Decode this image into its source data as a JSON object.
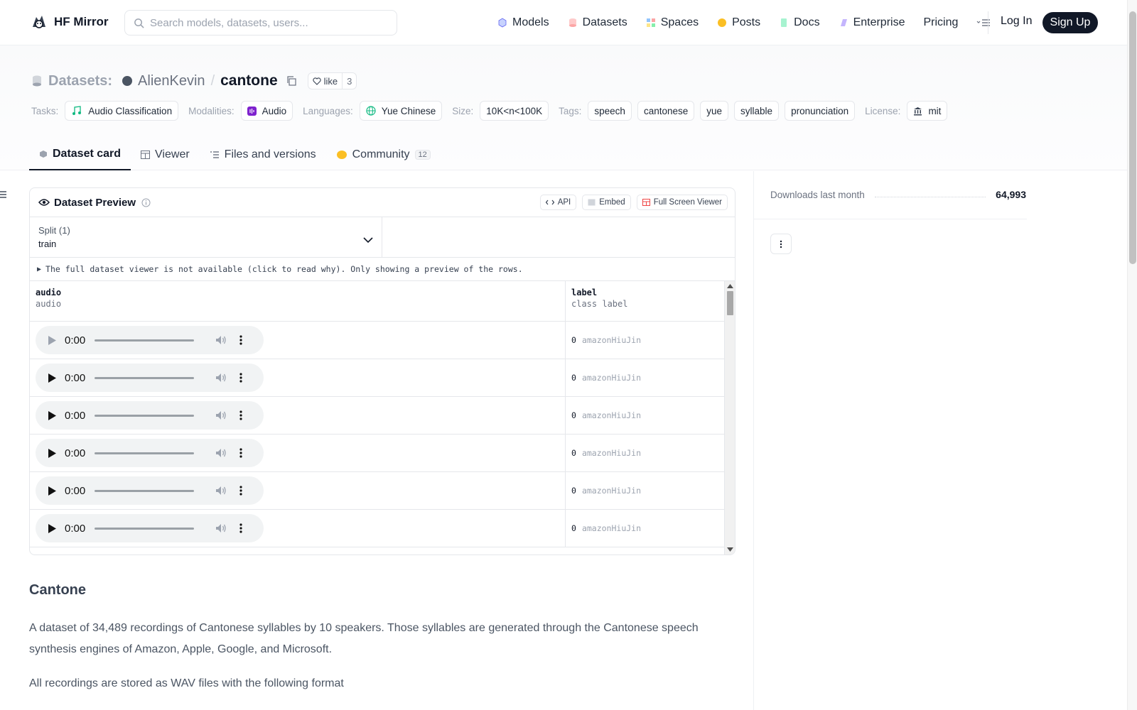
{
  "nav": {
    "brand": "HF Mirror",
    "search_placeholder": "Search models, datasets, users...",
    "links": [
      {
        "label": "Models",
        "icon": "models-icon",
        "color": "#6366f1"
      },
      {
        "label": "Datasets",
        "icon": "datasets-icon",
        "color": "#ef4444"
      },
      {
        "label": "Spaces",
        "icon": "spaces-icon",
        "color": "#3b82f6"
      },
      {
        "label": "Posts",
        "icon": "posts-icon",
        "color": "#f59e0b"
      },
      {
        "label": "Docs",
        "icon": "docs-icon",
        "color": "#10b981"
      },
      {
        "label": "Enterprise",
        "icon": "enterprise-icon",
        "color": "#8b5cf6"
      },
      {
        "label": "Pricing",
        "icon": "",
        "color": ""
      }
    ],
    "login": "Log In",
    "signup": "Sign Up"
  },
  "header": {
    "section_label": "Datasets:",
    "owner": "AlienKevin",
    "separator": "/",
    "repo": "cantone",
    "like_label": "like",
    "like_count": "3",
    "tags": {
      "tasks_label": "Tasks:",
      "task": "Audio Classification",
      "modalities_label": "Modalities:",
      "modality": "Audio",
      "languages_label": "Languages:",
      "language": "Yue Chinese",
      "size_label": "Size:",
      "size": "10K<n<100K",
      "tags_label": "Tags:",
      "tag_list": [
        "speech",
        "cantonese",
        "yue",
        "syllable",
        "pronunciation"
      ],
      "license_label": "License:",
      "license": "mit"
    },
    "tabs": [
      {
        "label": "Dataset card",
        "active": true
      },
      {
        "label": "Viewer",
        "active": false
      },
      {
        "label": "Files and versions",
        "active": false
      },
      {
        "label": "Community",
        "active": false,
        "count": "12"
      }
    ]
  },
  "preview": {
    "title": "Dataset Preview",
    "buttons": {
      "api": "API",
      "embed": "Embed",
      "fullscreen": "Full Screen Viewer"
    },
    "split_label": "Split (1)",
    "split_value": "train",
    "notice": "The full dataset viewer is not available (click to read why). Only showing a preview of the rows.",
    "columns": [
      {
        "name": "audio",
        "type": "audio"
      },
      {
        "name": "label",
        "type": "class label"
      }
    ],
    "rows": [
      {
        "time": "0:00",
        "label_idx": "0",
        "label_name": "amazonHiuJin"
      },
      {
        "time": "0:00",
        "label_idx": "0",
        "label_name": "amazonHiuJin"
      },
      {
        "time": "0:00",
        "label_idx": "0",
        "label_name": "amazonHiuJin"
      },
      {
        "time": "0:00",
        "label_idx": "0",
        "label_name": "amazonHiuJin"
      },
      {
        "time": "0:00",
        "label_idx": "0",
        "label_name": "amazonHiuJin"
      },
      {
        "time": "0:00",
        "label_idx": "0",
        "label_name": "amazonHiuJin"
      }
    ]
  },
  "card": {
    "heading": "Cantone",
    "paragraph1": "A dataset of 34,489 recordings of Cantonese syllables by 10 speakers. Those syllables are generated through the Cantonese speech synthesis engines of Amazon, Apple, Google, and Microsoft.",
    "paragraph2": "All recordings are stored as WAV files with the following format"
  },
  "sidebar": {
    "downloads_label": "Downloads last month",
    "downloads_value": "64,993"
  }
}
